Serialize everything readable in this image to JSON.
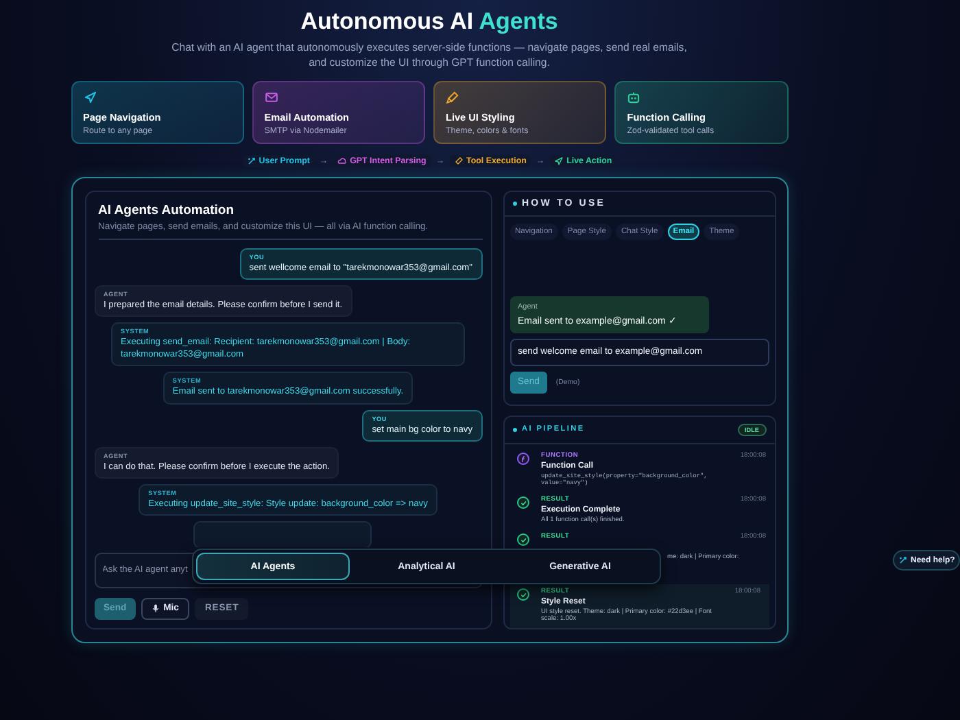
{
  "header": {
    "title": "Autonomous AI",
    "accent": "Agents",
    "subtitle": "Chat with an AI agent that autonomously executes server-side functions — navigate pages, send real emails, and customize the UI through GPT function calling."
  },
  "features": [
    {
      "kind": "navigation",
      "title": "Page Navigation",
      "subtitle": "Route to any page",
      "color": "#22c3e6"
    },
    {
      "kind": "email",
      "title": "Email Automation",
      "subtitle": "SMTP via Nodemailer",
      "color": "#c85be8"
    },
    {
      "kind": "styling",
      "title": "Live UI Styling",
      "subtitle": "Theme, colors & fonts",
      "color": "#f0a82c"
    },
    {
      "kind": "function",
      "title": "Function Calling",
      "subtitle": "Zod-validated tool calls",
      "color": "#2ed39a"
    }
  ],
  "flow": [
    {
      "kind": "prompt",
      "label": "User Prompt",
      "color": "#22c3e6",
      "separator": "→"
    },
    {
      "kind": "parsing",
      "label": "GPT Intent Parsing",
      "color": "#d65be8",
      "separator": "→"
    },
    {
      "kind": "tool",
      "label": "Tool Execution",
      "color": "#f0a82c",
      "separator": "→"
    },
    {
      "kind": "action",
      "label": "Live Action",
      "color": "#2ed39a"
    }
  ],
  "chat": {
    "title": "AI Agents Automation",
    "subtitle": "Navigate pages, send emails, and customize this UI — all via AI function calling.",
    "messages": [
      {
        "kind": "user",
        "role": "YOU",
        "text": "sent wellcome email to \"tarekmonowar353@gmail.com\""
      },
      {
        "kind": "agent",
        "role": "AGENT",
        "text": "I prepared the email details. Please confirm before I send it."
      },
      {
        "kind": "system",
        "role": "SYSTEM",
        "text": "Executing send_email: Recipient: tarekmonowar353@gmail.com | Body: tarekmonowar353@gmail.com"
      },
      {
        "kind": "system",
        "role": "SYSTEM",
        "text": "Email sent to tarekmonowar353@gmail.com successfully."
      },
      {
        "kind": "user",
        "role": "YOU",
        "text": "set main bg color to navy"
      },
      {
        "kind": "agent",
        "role": "AGENT",
        "text": "I can do that. Please confirm before I execute the action."
      },
      {
        "kind": "system",
        "role": "SYSTEM",
        "text": "Executing update_site_style: Style update: background_color => navy"
      }
    ],
    "input": {
      "placeholder": "Ask the AI agent anyt"
    },
    "send": "Send",
    "mic": "Mic",
    "reset": "RESET"
  },
  "how_to_use": {
    "title": "HOW TO USE",
    "tabs": [
      {
        "label": "Navigation",
        "selected": false
      },
      {
        "label": "Page Style",
        "selected": false
      },
      {
        "label": "Chat Style",
        "selected": false
      },
      {
        "label": "Email",
        "selected": true
      },
      {
        "label": "Theme",
        "selected": false
      }
    ],
    "demo": {
      "role": "Agent",
      "reply": "Email sent to example@gmail.com ✓",
      "input": "send welcome email to example@gmail.com",
      "send": "Send",
      "note": "(Demo)"
    }
  },
  "pipeline": {
    "title": "AI PIPELINE",
    "status": "IDLE",
    "events": [
      {
        "kind": "function",
        "label": "FUNCTION",
        "title": "Function Call",
        "detail": "update_site_style(property=\"background_color\", value=\"navy\")",
        "time": "18:00:08"
      },
      {
        "kind": "result",
        "label": "RESULT",
        "title": "Execution Complete",
        "detail": "All 1 function call(s) finished.",
        "time": "18:00:08"
      },
      {
        "kind": "covered",
        "label": "RESULT",
        "detail": "me: dark | Primary color:",
        "time": "18:00:08"
      },
      {
        "kind": "result",
        "label": "RESULT",
        "title": "Style Reset",
        "detail": "UI style reset. Theme: dark | Primary color: #22d3ee | Font scale: 1.00x",
        "time": "18:00:08"
      }
    ]
  },
  "mode_switcher": {
    "tabs": [
      {
        "label": "AI Agents",
        "selected": true
      },
      {
        "label": "Analytical AI",
        "selected": false
      },
      {
        "label": "Generative AI",
        "selected": false
      }
    ]
  },
  "help": {
    "label": "Need help?"
  }
}
